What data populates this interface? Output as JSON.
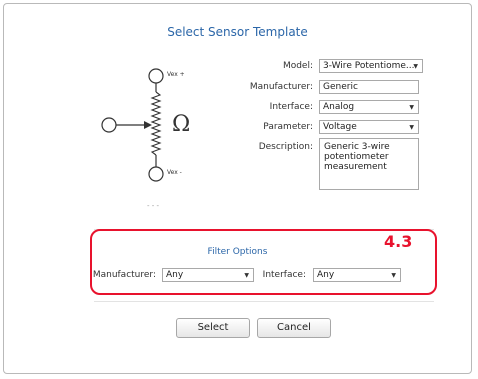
{
  "dialog": {
    "title": "Select Sensor Template"
  },
  "diagram": {
    "vex_plus": "Vex +",
    "vex_minus": "Vex -",
    "ohm_symbol": "Ω",
    "more": "- - -"
  },
  "form": {
    "model_label": "Model:",
    "model_value": "3-Wire Potentiome...",
    "manufacturer_label": "Manufacturer:",
    "manufacturer_value": "Generic",
    "interface_label": "Interface:",
    "interface_value": "Analog",
    "parameter_label": "Parameter:",
    "parameter_value": "Voltage",
    "description_label": "Description:",
    "description_line1": "Generic 3-wire",
    "description_line2": "potentiometer",
    "description_line3": "measurement"
  },
  "filter": {
    "title": "Filter Options",
    "manufacturer_label": "Manufacturer:",
    "manufacturer_value": "Any",
    "interface_label": "Interface:",
    "interface_value": "Any"
  },
  "annotation": {
    "label": "4.3",
    "color": "#e8122d"
  },
  "buttons": {
    "select": "Select",
    "cancel": "Cancel"
  },
  "icons": {
    "dropdown": "▼"
  },
  "colors": {
    "accent": "#2b66a8",
    "highlight": "#e8122d"
  }
}
